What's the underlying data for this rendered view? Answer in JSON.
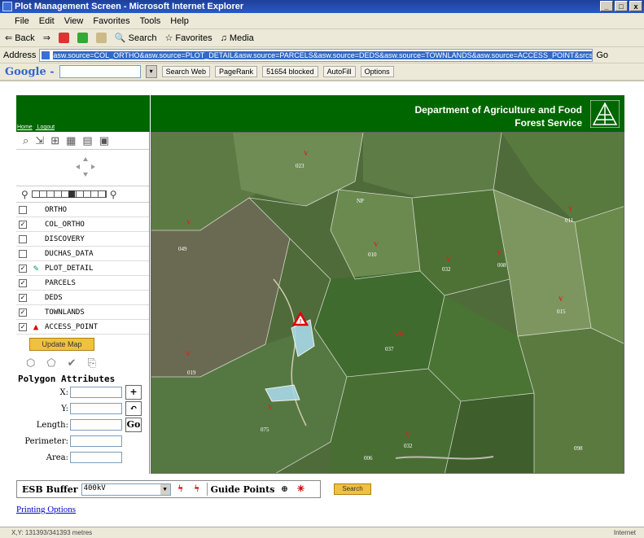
{
  "window": {
    "title": "Plot Management Screen - Microsoft Internet Explorer",
    "buttons": [
      "_",
      "□",
      "x"
    ]
  },
  "menu": [
    "File",
    "Edit",
    "View",
    "Favorites",
    "Tools",
    "Help"
  ],
  "toolbar": {
    "back": "Back",
    "search": "Search",
    "favorites": "Favorites",
    "media": "Media"
  },
  "address": {
    "label": "Address",
    "url": "asw.source=COL_ORTHO&asw.source=PLOT_DETAIL&asw.source=PARCELS&asw.source=DEDS&asw.source=TOWNLANDS&asw.source=ACCESS_POINT&srcsb=++Update+Map++",
    "go": "Go"
  },
  "google": {
    "logo": "Google -",
    "search_web": "Search Web",
    "pagerank": "PageRank",
    "blocked": "51654 blocked",
    "autofill": "AutoFill",
    "options": "Options"
  },
  "header": {
    "links": [
      "Home",
      "Logout"
    ],
    "dept_line1": "Department of Agriculture and Food",
    "dept_line2": "Forest Service"
  },
  "layers": [
    {
      "name": "ORTHO",
      "checked": false,
      "icon": ""
    },
    {
      "name": "COL_ORTHO",
      "checked": true,
      "icon": ""
    },
    {
      "name": "DISCOVERY",
      "checked": false,
      "icon": ""
    },
    {
      "name": "DUCHAS_DATA",
      "checked": false,
      "icon": ""
    },
    {
      "name": "PLOT_DETAIL",
      "checked": true,
      "icon": "plot-icon"
    },
    {
      "name": "PARCELS",
      "checked": true,
      "icon": ""
    },
    {
      "name": "DEDS",
      "checked": true,
      "icon": ""
    },
    {
      "name": "TOWNLANDS",
      "checked": true,
      "icon": ""
    },
    {
      "name": "ACCESS_POINT",
      "checked": true,
      "icon": "warning-triangle-icon"
    }
  ],
  "update_map_label": "Update Map",
  "polygon": {
    "title": "Polygon Attributes",
    "x_label": "X:",
    "y_label": "Y:",
    "length_label": "Length:",
    "perimeter_label": "Perimeter:",
    "area_label": "Area:",
    "add_btn": "+",
    "undo_btn": "↶",
    "go_btn": "Go"
  },
  "map_labels": [
    {
      "id": "l023",
      "text": "023"
    },
    {
      "id": "lnp",
      "text": "NP"
    },
    {
      "id": "l011",
      "text": "011"
    },
    {
      "id": "l049",
      "text": "049"
    },
    {
      "id": "l010",
      "text": "010"
    },
    {
      "id": "l032",
      "text": "032"
    },
    {
      "id": "l008",
      "text": "008"
    },
    {
      "id": "l015",
      "text": "015"
    },
    {
      "id": "l037",
      "text": "037"
    },
    {
      "id": "l019",
      "text": "019"
    },
    {
      "id": "l075",
      "text": "075"
    },
    {
      "id": "l032b",
      "text": "032"
    },
    {
      "id": "l006",
      "text": "006"
    },
    {
      "id": "l098",
      "text": "098"
    }
  ],
  "esb": {
    "label": "ESB Buffer",
    "value": "400kV"
  },
  "guide_points_label": "Guide Points",
  "search_label": "Search",
  "printing_options": "Printing Options",
  "status": {
    "text": "X,Y: 131393/341393 metres",
    "zone": "Internet"
  },
  "colors": {
    "green": "#006600",
    "yellow_btn": "#f0c040",
    "link": "#0000cc"
  }
}
